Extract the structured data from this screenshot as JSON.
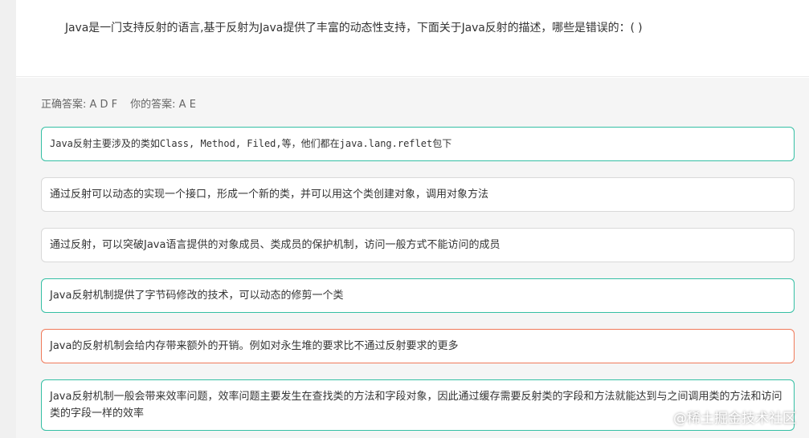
{
  "question": {
    "text": "Java是一门支持反射的语言,基于反射为Java提供了丰富的动态性支持，下面关于Java反射的描述，哪些是错误的：(          )"
  },
  "answers": {
    "correct_label": "正确答案: A D F",
    "yours_label": "你的答案: A E"
  },
  "options": [
    {
      "text": "Java反射主要涉及的类如Class, Method, Filed,等，他们都在java.lang.reflet包下",
      "status": "correct"
    },
    {
      "text": "通过反射可以动态的实现一个接口，形成一个新的类，并可以用这个类创建对象，调用对象方法",
      "status": "neutral"
    },
    {
      "text": "通过反射，可以突破Java语言提供的对象成员、类成员的保护机制，访问一般方式不能访问的成员",
      "status": "neutral"
    },
    {
      "text": "Java反射机制提供了字节码修改的技术，可以动态的修剪一个类",
      "status": "correct"
    },
    {
      "text": "Java的反射机制会给内存带来额外的开销。例如对永生堆的要求比不通过反射要求的更多",
      "status": "wrong"
    },
    {
      "text": "Java反射机制一般会带来效率问题，效率问题主要发生在查找类的方法和字段对象，因此通过缓存需要反射类的字段和方法就能达到与之间调用类的方法和访问类的字段一样的效率",
      "status": "correct"
    }
  ],
  "watermark": {
    "text": "@稀土掘金技术社区"
  },
  "colors": {
    "correct_border": "#35bfa4",
    "wrong_border": "#f07a5a",
    "neutral_border": "#d9d9d9"
  }
}
